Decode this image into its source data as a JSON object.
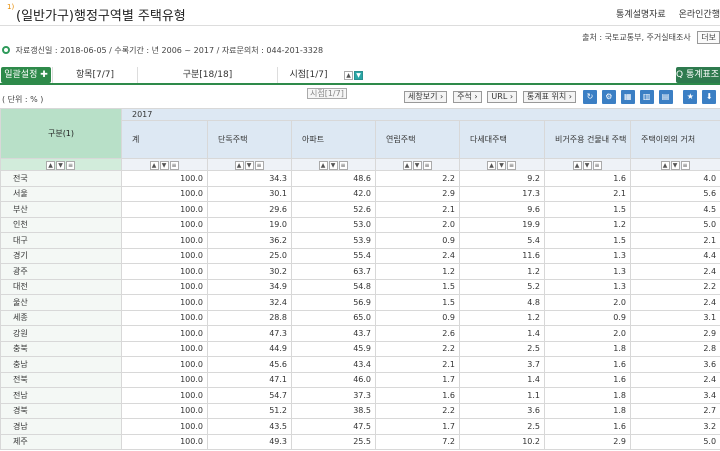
{
  "header": {
    "title_num": "1)",
    "title": "(일반가구)행정구역별 주택유형",
    "links": [
      "통계설명자료",
      "온라인간행"
    ]
  },
  "source": {
    "text": "출처 : 국토교통부, 주거실태조사",
    "cite_label": "더보"
  },
  "meta": {
    "text": "자료갱신일 : 2018-06-05 / 수록기간 : 년 2006 ~ 2017 / 자료문의처 : 044-201-3328"
  },
  "tabbar": {
    "settings_label": "일괄설정 ✚",
    "tabs": [
      "항목[7/7]",
      "구분[18/18]",
      "시점[1/7]"
    ],
    "stat_button": "Q 통계표조"
  },
  "tooltip": "시점[1/7]",
  "unit": "( 단위 : % )",
  "toolbar": {
    "buttons": [
      "세창보기 ›",
      "주석 ›",
      "URL ›",
      "통계표 위치 ›"
    ],
    "icons": [
      "refresh-icon",
      "settings-icon",
      "table-icon",
      "chart-icon",
      "map-icon",
      "favorite-icon",
      "download-icon",
      "print-icon"
    ]
  },
  "table": {
    "row_header": "구분(1)",
    "year": "2017",
    "columns": [
      "계",
      "단독주택",
      "아파트",
      "연립주택",
      "다세대주택",
      "비거주용 건물내 주택",
      "주택이외의 거처"
    ],
    "rows": [
      {
        "name": "전국",
        "values": [
          "100.0",
          "34.3",
          "48.6",
          "2.2",
          "9.2",
          "1.6",
          "4.0"
        ]
      },
      {
        "name": "서울",
        "values": [
          "100.0",
          "30.1",
          "42.0",
          "2.9",
          "17.3",
          "2.1",
          "5.6"
        ]
      },
      {
        "name": "부산",
        "values": [
          "100.0",
          "29.6",
          "52.6",
          "2.1",
          "9.6",
          "1.5",
          "4.5"
        ]
      },
      {
        "name": "인천",
        "values": [
          "100.0",
          "19.0",
          "53.0",
          "2.0",
          "19.9",
          "1.2",
          "5.0"
        ]
      },
      {
        "name": "대구",
        "values": [
          "100.0",
          "36.2",
          "53.9",
          "0.9",
          "5.4",
          "1.5",
          "2.1"
        ]
      },
      {
        "name": "경기",
        "values": [
          "100.0",
          "25.0",
          "55.4",
          "2.4",
          "11.6",
          "1.3",
          "4.4"
        ]
      },
      {
        "name": "광주",
        "values": [
          "100.0",
          "30.2",
          "63.7",
          "1.2",
          "1.2",
          "1.3",
          "2.4"
        ]
      },
      {
        "name": "대전",
        "values": [
          "100.0",
          "34.9",
          "54.8",
          "1.5",
          "5.2",
          "1.3",
          "2.2"
        ]
      },
      {
        "name": "울산",
        "values": [
          "100.0",
          "32.4",
          "56.9",
          "1.5",
          "4.8",
          "2.0",
          "2.4"
        ]
      },
      {
        "name": "세종",
        "values": [
          "100.0",
          "28.8",
          "65.0",
          "0.9",
          "1.2",
          "0.9",
          "3.1"
        ]
      },
      {
        "name": "강원",
        "values": [
          "100.0",
          "47.3",
          "43.7",
          "2.6",
          "1.4",
          "2.0",
          "2.9"
        ]
      },
      {
        "name": "충북",
        "values": [
          "100.0",
          "44.9",
          "45.9",
          "2.2",
          "2.5",
          "1.8",
          "2.8"
        ]
      },
      {
        "name": "충남",
        "values": [
          "100.0",
          "45.6",
          "43.4",
          "2.1",
          "3.7",
          "1.6",
          "3.6"
        ]
      },
      {
        "name": "전북",
        "values": [
          "100.0",
          "47.1",
          "46.0",
          "1.7",
          "1.4",
          "1.6",
          "2.4"
        ]
      },
      {
        "name": "전남",
        "values": [
          "100.0",
          "54.7",
          "37.3",
          "1.6",
          "1.1",
          "1.8",
          "3.4"
        ]
      },
      {
        "name": "경북",
        "values": [
          "100.0",
          "51.2",
          "38.5",
          "2.2",
          "3.6",
          "1.8",
          "2.7"
        ]
      },
      {
        "name": "경남",
        "values": [
          "100.0",
          "43.5",
          "47.5",
          "1.7",
          "2.5",
          "1.6",
          "3.2"
        ]
      },
      {
        "name": "제주",
        "values": [
          "100.0",
          "49.3",
          "25.5",
          "7.2",
          "10.2",
          "2.9",
          "5.0"
        ]
      }
    ]
  }
}
